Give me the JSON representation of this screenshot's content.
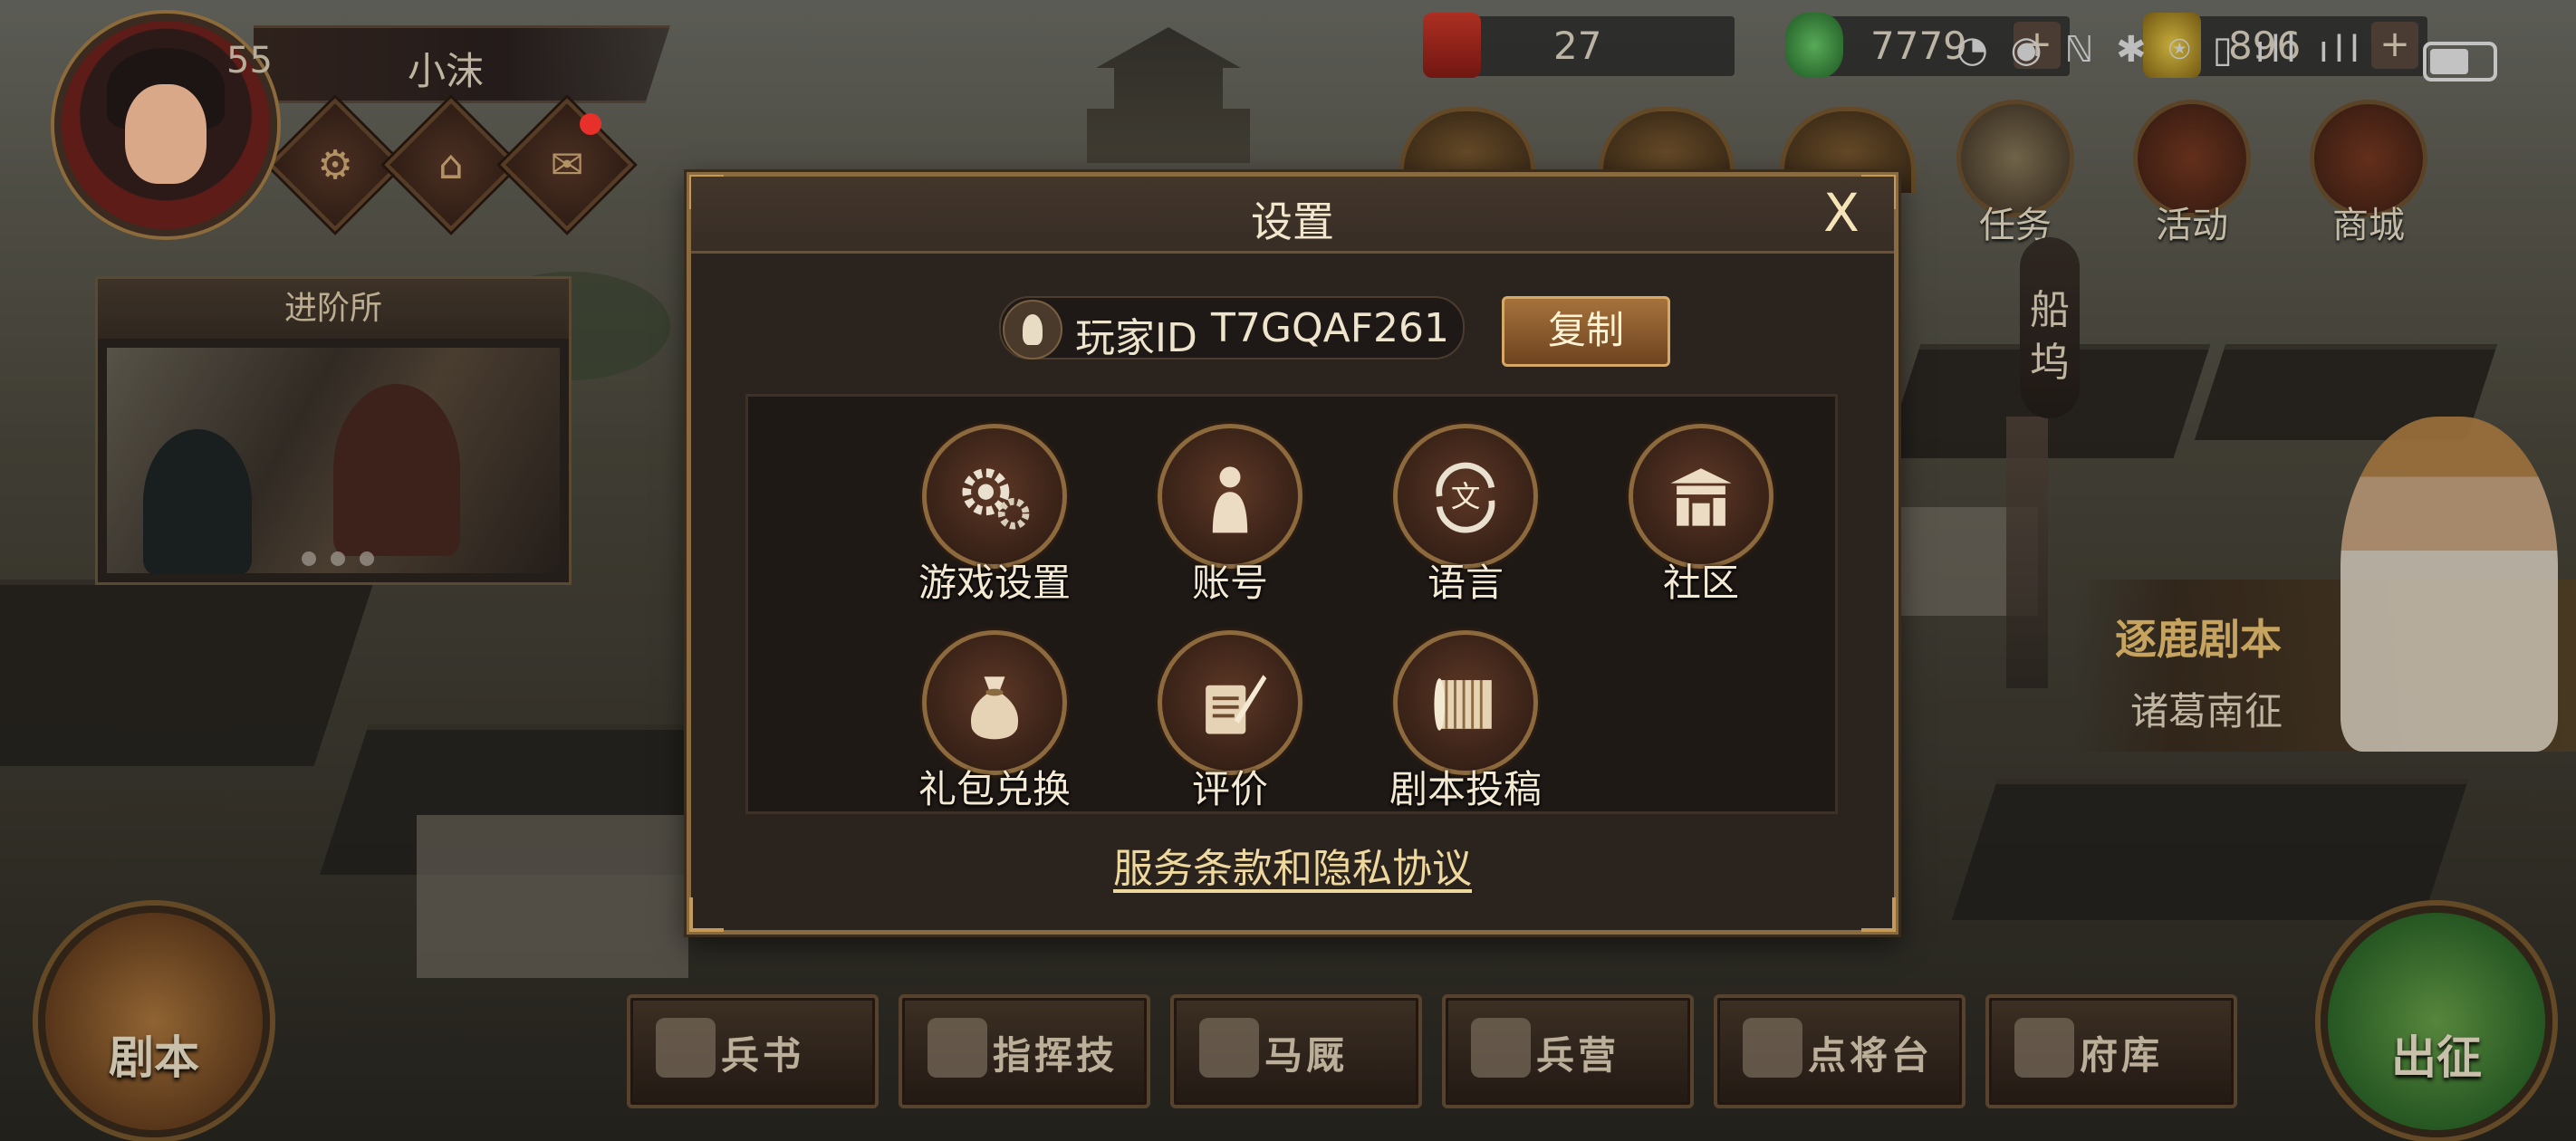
{
  "player": {
    "level": "55",
    "name": "小沫"
  },
  "advance_hall": {
    "title": "进阶所"
  },
  "resources": [
    {
      "icon": "red-token-icon",
      "value": "27"
    },
    {
      "icon": "jade-icon",
      "value": "7779"
    },
    {
      "icon": "gold-ingot-icon",
      "value": "896"
    }
  ],
  "status_bar": {
    "glyphs": "◔ ◉ ℕ ✱ ⍟ ▯ ıll ıll"
  },
  "top_menu": [
    {
      "label": "任务",
      "icon": "scroll-icon"
    },
    {
      "label": "活动",
      "icon": "gong-icon"
    },
    {
      "label": "商城",
      "icon": "shop-icon"
    }
  ],
  "dock": {
    "label": "船坞"
  },
  "script_banner": {
    "title": "逐鹿剧本",
    "subtitle": "诸葛南征"
  },
  "bottom_nav": {
    "left_round": "剧本",
    "right_round": "出征",
    "buttons": [
      "兵书",
      "指挥技",
      "马厩",
      "兵营",
      "点将台",
      "府库"
    ]
  },
  "dialog": {
    "title": "设置",
    "close_glyph": "X",
    "player_id_label": "玩家ID",
    "player_id_value": "T7GQAF261",
    "copy_label": "复制",
    "options": [
      {
        "label": "游戏设置",
        "icon": "gears-icon"
      },
      {
        "label": "账号",
        "icon": "account-icon"
      },
      {
        "label": "语言",
        "icon": "language-icon"
      },
      {
        "label": "社区",
        "icon": "community-gate-icon"
      },
      {
        "label": "礼包兑换",
        "icon": "gift-bag-icon"
      },
      {
        "label": "评价",
        "icon": "review-quill-icon"
      },
      {
        "label": "剧本投稿",
        "icon": "script-scroll-icon"
      }
    ],
    "terms_link": "服务条款和隐私协议"
  },
  "colors": {
    "accent_gold": "#8a6a3f",
    "link": "#efd89e",
    "panel_bg": "#2b231e"
  }
}
